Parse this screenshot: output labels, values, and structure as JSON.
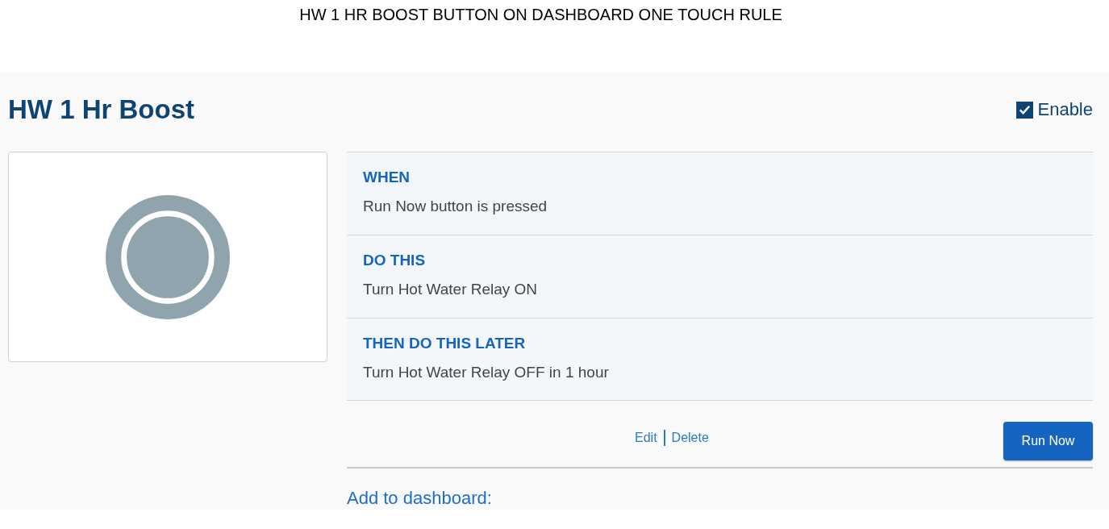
{
  "caption": "HW 1 HR BOOST BUTTON ON DASHBOARD ONE TOUCH RULE",
  "rule": {
    "title": "HW 1 Hr Boost",
    "enable": {
      "label": "Enable",
      "checked": true
    }
  },
  "sections": [
    {
      "heading": "WHEN",
      "text": "Run Now button is pressed"
    },
    {
      "heading": "DO THIS",
      "text": "Turn Hot Water Relay ON"
    },
    {
      "heading": "THEN DO THIS LATER",
      "text": "Turn Hot Water Relay OFF in 1 hour"
    }
  ],
  "links": [
    "Edit",
    "Delete"
  ],
  "run_button": "Run Now",
  "dashboard_label": "Add to dashboard:"
}
